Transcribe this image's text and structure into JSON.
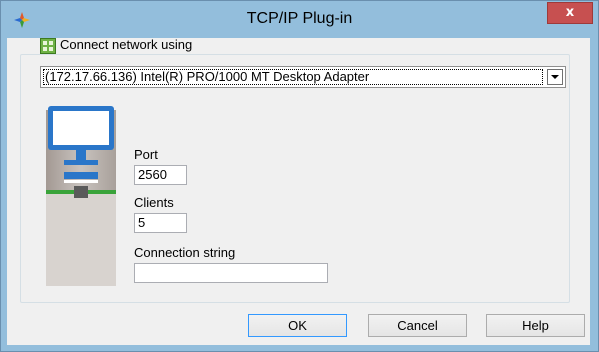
{
  "window": {
    "title": "TCP/IP Plug-in",
    "close_label": "x"
  },
  "network": {
    "label": "Connect network using",
    "selected_adapter": "(172.17.66.136) Intel(R) PRO/1000 MT Desktop Adapter"
  },
  "fields": {
    "port_label": "Port",
    "port_value": "2560",
    "clients_label": "Clients",
    "clients_value": "5",
    "connection_label": "Connection string",
    "connection_value": ""
  },
  "buttons": {
    "ok": "OK",
    "cancel": "Cancel",
    "help": "Help"
  },
  "colors": {
    "title_bar": "#93bedc",
    "close": "#c75050",
    "accent": "#3399ff"
  },
  "icons": {
    "app": "plugin-icon",
    "network": "network-icon",
    "computer": "computer-icon"
  }
}
